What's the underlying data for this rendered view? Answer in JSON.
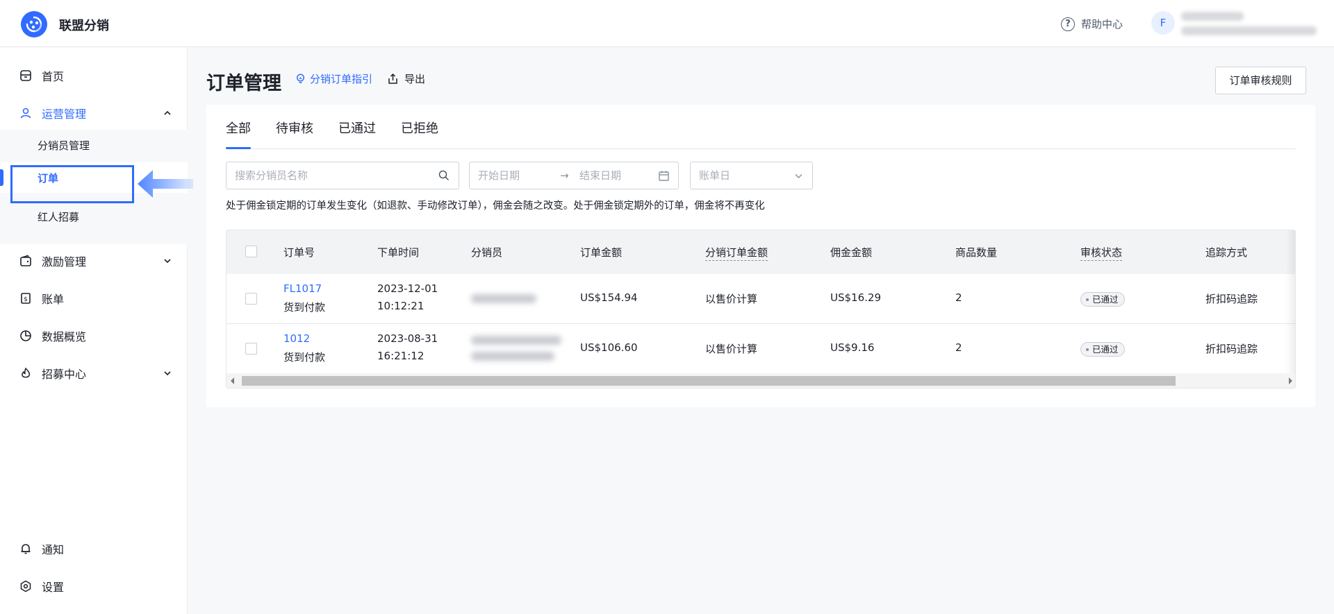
{
  "app": {
    "title": "联盟分销"
  },
  "header": {
    "help_label": "帮助中心",
    "avatar_letter": "F"
  },
  "sidebar": {
    "items": [
      {
        "label": "首页",
        "icon": "store-icon"
      },
      {
        "label": "运营管理",
        "icon": "user-icon",
        "expanded": true
      },
      {
        "label": "激励管理",
        "icon": "wallet-icon"
      },
      {
        "label": "账单",
        "icon": "bill-icon"
      },
      {
        "label": "数据概览",
        "icon": "pie-chart-icon"
      },
      {
        "label": "招募中心",
        "icon": "flame-icon"
      }
    ],
    "sub_items": [
      {
        "label": "分销员管理"
      },
      {
        "label": "订单",
        "active": true
      },
      {
        "label": "红人招募"
      }
    ],
    "bottom": [
      {
        "label": "通知",
        "icon": "bell-icon"
      },
      {
        "label": "设置",
        "icon": "settings-icon"
      }
    ]
  },
  "page": {
    "title": "订单管理",
    "guide_label": "分销订单指引",
    "export_label": "导出",
    "rule_button": "订单审核规则"
  },
  "tabs": [
    "全部",
    "待审核",
    "已通过",
    "已拒绝"
  ],
  "filters": {
    "search_placeholder": "搜索分销员名称",
    "start_date": "开始日期",
    "end_date": "结束日期",
    "bill_day": "账单日"
  },
  "notice": "处于佣金锁定期的订单发生变化（如退款、手动修改订单），佣金会随之改变。处于佣金锁定期外的订单，佣金将不再变化",
  "table": {
    "columns": [
      "订单号",
      "下单时间",
      "分销员",
      "订单金额",
      "分销订单金额",
      "佣金金额",
      "商品数量",
      "审核状态",
      "追踪方式"
    ],
    "rows": [
      {
        "order_no": "FL1017",
        "payment": "货到付款",
        "date": "2023-12-01",
        "time": "10:12:21",
        "amount": "US$154.94",
        "dist_amount": "以售价计算",
        "commission": "US$16.29",
        "qty": "2",
        "status": "已通过",
        "tracking": "折扣码追踪"
      },
      {
        "order_no": "1012",
        "payment": "货到付款",
        "date": "2023-08-31",
        "time": "16:21:12",
        "amount": "US$106.60",
        "dist_amount": "以售价计算",
        "commission": "US$9.16",
        "qty": "2",
        "status": "已通过",
        "tracking": "折扣码追踪"
      }
    ]
  },
  "colors": {
    "accent": "#2f6bff",
    "text": "#1d2129",
    "muted": "#86909c"
  }
}
